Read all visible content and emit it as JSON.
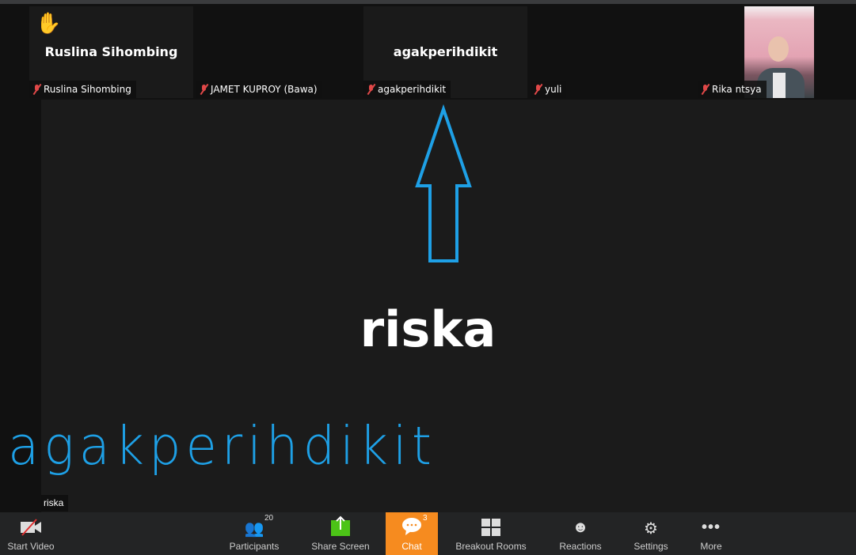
{
  "thumbnails": [
    {
      "name": "Ruslina Sihombing",
      "display": "Ruslina Sihombing",
      "raised_hand": true,
      "muted": true
    },
    {
      "name": "JAMET KUPROY (Bawa)",
      "display": "",
      "muted": true
    },
    {
      "name": "agakperihdikit",
      "display": "agakperihdikit",
      "muted": true
    },
    {
      "name": "yuli",
      "display": "",
      "muted": true
    },
    {
      "name": "Rika ntsya",
      "display": "",
      "video": true,
      "muted": true
    }
  ],
  "main": {
    "speaker": "riska",
    "label": "riska",
    "overlay_text": "agakperihdikit",
    "annotation_color": "#1ea0e6"
  },
  "toolbar": {
    "start_video": "Start Video",
    "participants": "Participants",
    "participants_count": "20",
    "share_screen": "Share Screen",
    "chat": "Chat",
    "chat_count": "3",
    "breakout": "Breakout Rooms",
    "reactions": "Reactions",
    "settings": "Settings",
    "more": "More",
    "accent": "#f68b1f",
    "share_color": "#4cc417"
  }
}
